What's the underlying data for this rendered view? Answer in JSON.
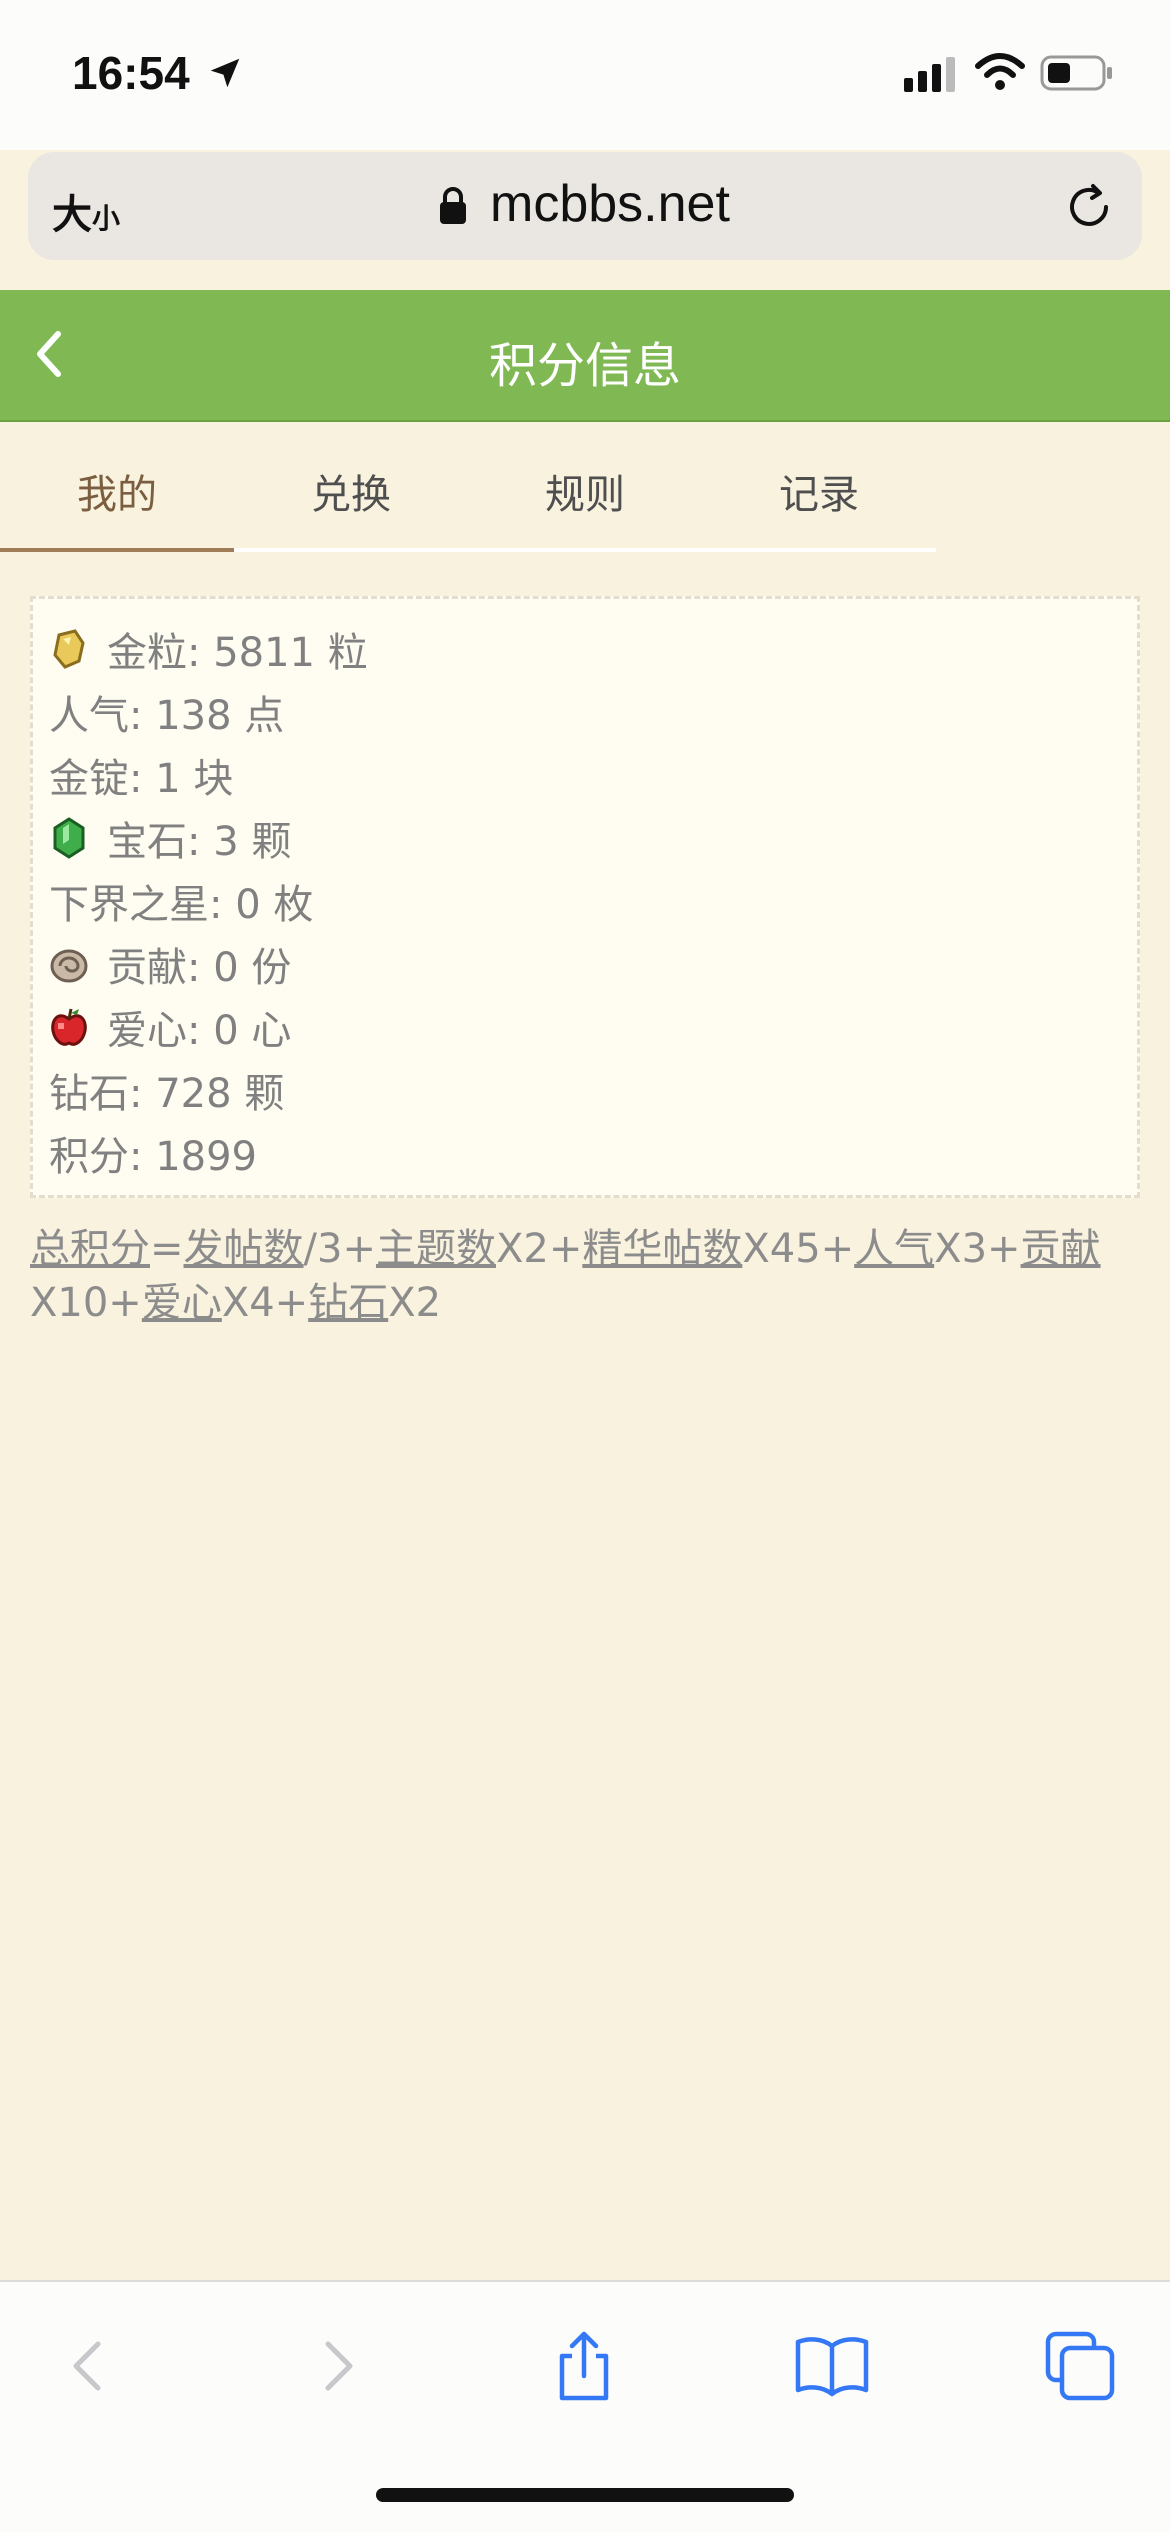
{
  "status": {
    "time": "16:54"
  },
  "browser": {
    "text_size_big": "大",
    "text_size_small": "小",
    "url": "mcbbs.net"
  },
  "header": {
    "title": "积分信息"
  },
  "tabs": [
    "我的",
    "兑换",
    "规则",
    "记录"
  ],
  "stats": [
    {
      "label": "金粒: 5811 粒",
      "icon": "gold-nugget-icon"
    },
    {
      "label": "人气: 138 点",
      "icon": ""
    },
    {
      "label": "金锭: 1 块",
      "icon": ""
    },
    {
      "label": "宝石: 3 颗",
      "icon": "emerald-icon"
    },
    {
      "label": "下界之星: 0 枚",
      "icon": ""
    },
    {
      "label": "贡献: 0 份",
      "icon": "nautilus-shell-icon"
    },
    {
      "label": "爱心: 0 心",
      "icon": "apple-icon"
    },
    {
      "label": "钻石: 728 颗",
      "icon": ""
    },
    {
      "label": "积分: 1899",
      "icon": ""
    }
  ],
  "formula": {
    "total": "总积分",
    "eq": "=",
    "posts": "发帖数",
    "p1": "/3+",
    "threads": "主题数",
    "p2": "X2+",
    "digest": "精华帖数",
    "p3": "X45+",
    "popularity": "人气",
    "p4": "X3+",
    "contribution": "贡献",
    "p5": "X10+",
    "love": "爱心",
    "p6": "X4+",
    "diamond": "钻石",
    "p7": "X2"
  },
  "colors": {
    "header_green": "#80b954",
    "page_bg": "#f8f2df",
    "ios_blue": "#3478f6"
  }
}
